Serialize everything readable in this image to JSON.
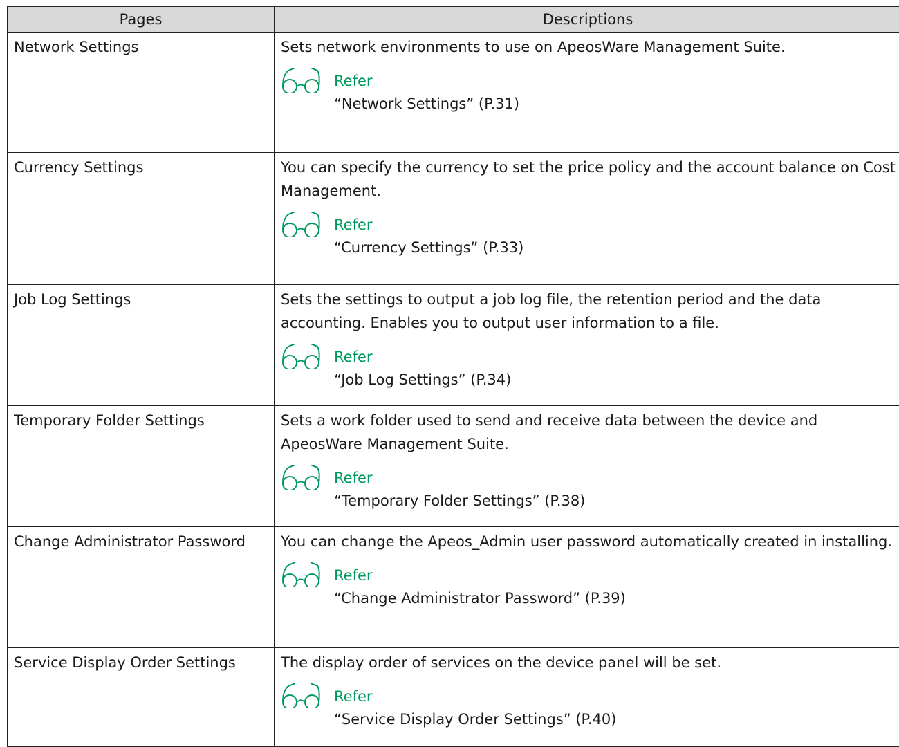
{
  "table": {
    "headers": {
      "pages": "Pages",
      "descriptions": "Descriptions"
    },
    "refer_color": "#009a5e",
    "header_bg": "#d9d9d9",
    "rows": [
      {
        "page": "Network Settings",
        "description": "Sets network environments to use on ApeosWare Management Suite.",
        "refer_label": "Refer",
        "refer_target": "“Network Settings” (P.31)"
      },
      {
        "page": "Currency Settings",
        "description": "You can specify the currency to set the price policy and the account balance on Cost Management.",
        "refer_label": "Refer",
        "refer_target": "“Currency Settings” (P.33)"
      },
      {
        "page": "Job Log Settings",
        "description": "Sets the settings to output a job log file, the retention period and the data accounting. Enables you to output user information to a file.",
        "refer_label": "Refer",
        "refer_target": "“Job Log Settings” (P.34)"
      },
      {
        "page": "Temporary Folder Settings",
        "description": "Sets a work folder used to send and receive data between the device and ApeosWare Management Suite.",
        "refer_label": "Refer",
        "refer_target": "“Temporary Folder Settings” (P.38)"
      },
      {
        "page": "Change Administrator Password",
        "description": "You can change the Apeos_Admin user password automatically created in installing.",
        "refer_label": "Refer",
        "refer_target": "“Change Administrator Password” (P.39)"
      },
      {
        "page": "Service Display Order Settings",
        "description": "The display order of services on the device panel will be set.",
        "refer_label": "Refer",
        "refer_target": "“Service Display Order Settings” (P.40)"
      }
    ]
  }
}
